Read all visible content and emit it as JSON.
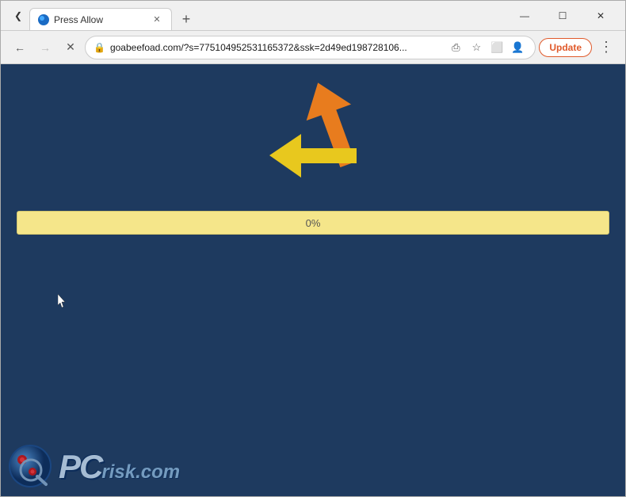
{
  "browser": {
    "tab": {
      "title": "Press Allow",
      "favicon": "globe-icon"
    },
    "new_tab_label": "+",
    "window_controls": {
      "chevron": "❮",
      "minimize": "—",
      "maximize": "☐",
      "close": "✕"
    },
    "nav": {
      "back_label": "←",
      "forward_label": "→",
      "reload_label": "✕",
      "url": "goabeefoad.com/?s=775104952531165372&ssk=2d49ed198728106...",
      "share_icon": "⎙",
      "bookmark_icon": "☆",
      "profile_icon": "◯",
      "update_label": "Update",
      "menu_label": "⋮"
    },
    "content": {
      "progress_text": "0%",
      "progress_percent": 0,
      "pcrisk_text": "PC",
      "pcrisk_suffix": "risk.com"
    }
  }
}
